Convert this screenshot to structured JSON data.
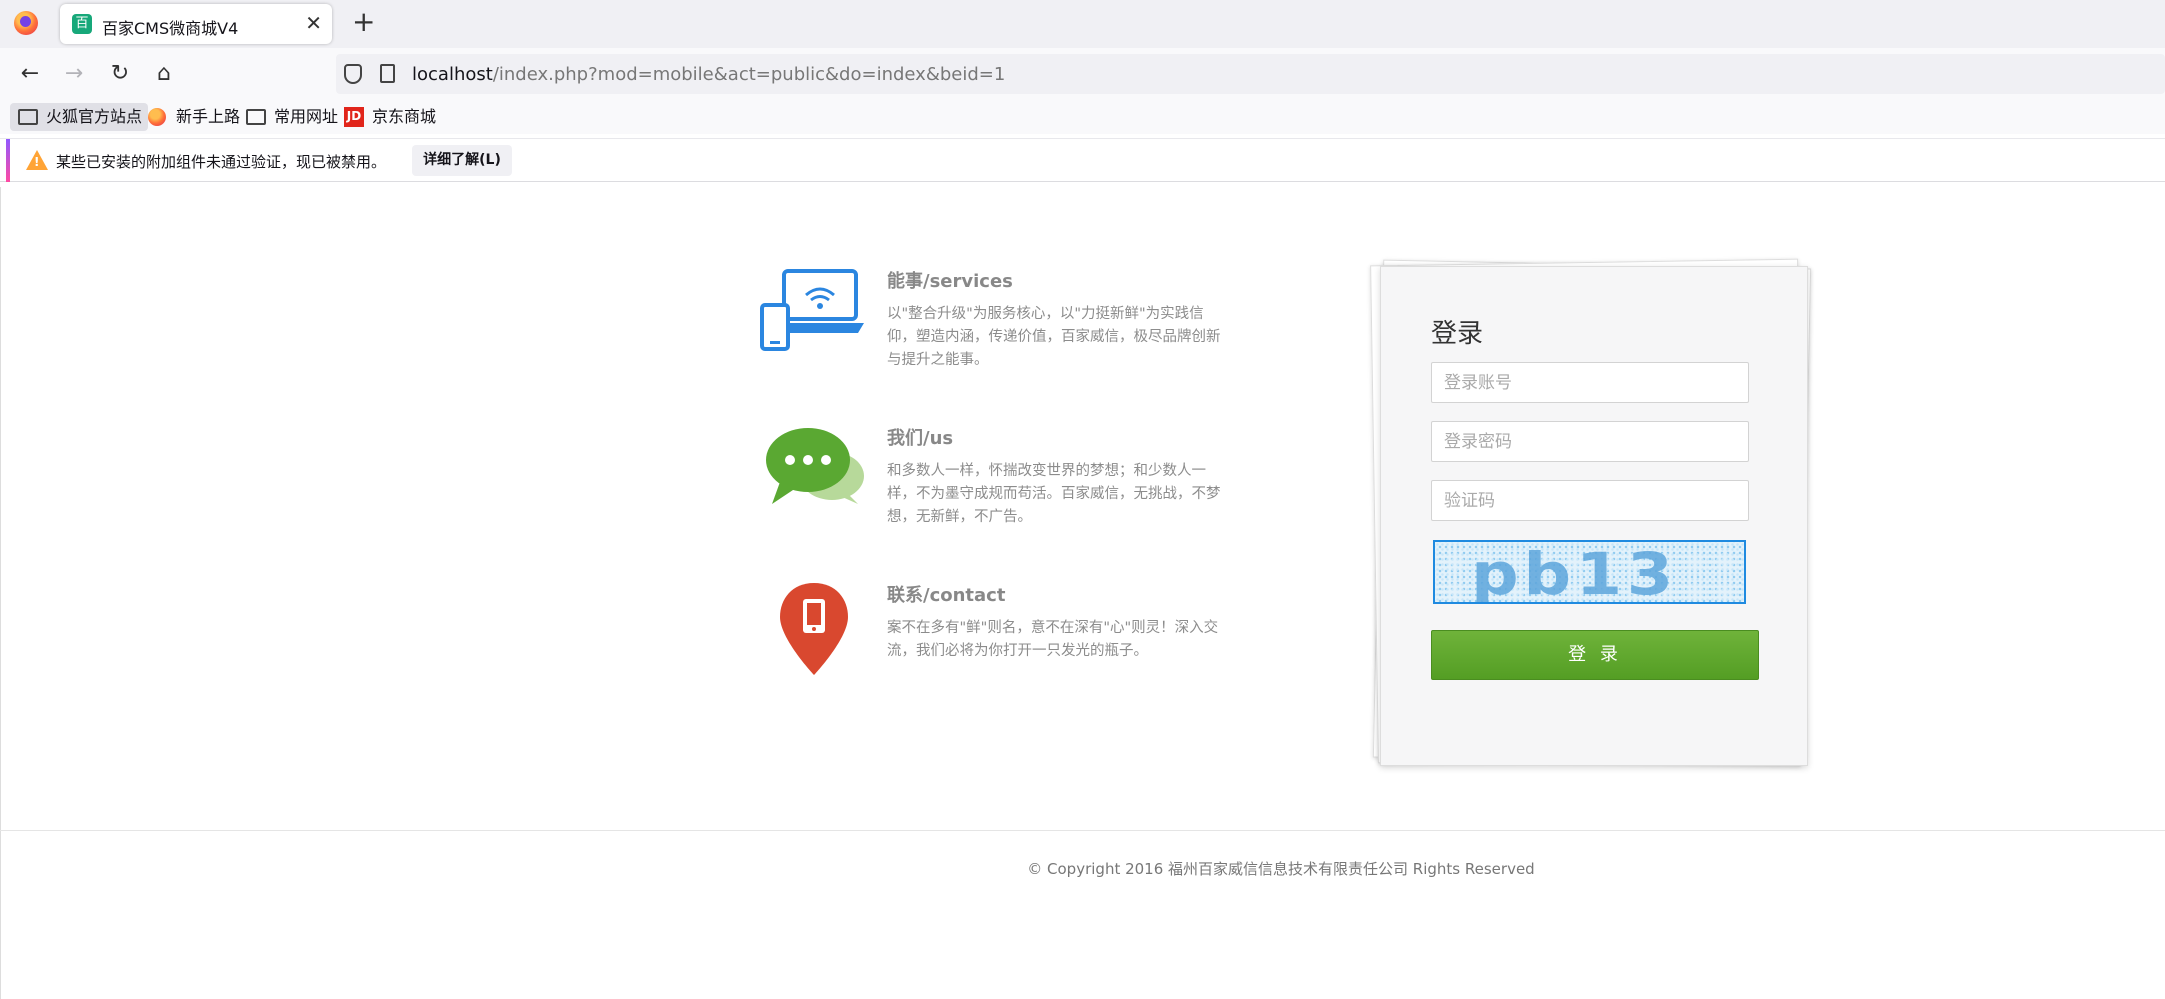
{
  "browser": {
    "tab_title": "百家CMS微商城V4",
    "tab_favicon": "百",
    "close_symbol": "✕",
    "new_tab_symbol": "+",
    "nav": {
      "back": "←",
      "forward": "→",
      "reload": "↻",
      "home": "⌂"
    },
    "url_host": "localhost",
    "url_path": "/index.php?mod=mobile&act=public&do=index&beid=1",
    "bookmarks": [
      {
        "label": "火狐官方站点",
        "icon": "folder-icon"
      },
      {
        "label": "新手上路",
        "icon": "firefox-icon"
      },
      {
        "label": "常用网址",
        "icon": "folder-icon"
      },
      {
        "label": "京东商城",
        "icon": "jd-icon",
        "icon_text": "JD"
      }
    ],
    "notification": {
      "text": "某些已安装的附加组件未通过验证，现已被禁用。",
      "button": "详细了解(L)"
    }
  },
  "features": [
    {
      "icon": "laptop-wifi-icon",
      "title": "能事/services",
      "text": "以\"整合升级\"为服务核心，以\"力挺新鲜\"为实践信仰，塑造内涵，传递价值，百家威信，极尽品牌创新与提升之能事。"
    },
    {
      "icon": "chat-bubbles-icon",
      "title": "我们/us",
      "text": "和多数人一样，怀揣改变世界的梦想；和少数人一样，不为墨守成规而苟活。百家威信，无挑战，不梦想，无新鲜，不广告。"
    },
    {
      "icon": "map-pin-phone-icon",
      "title": "联系/contact",
      "text": "案不在多有\"鲜\"则名，意不在深有\"心\"则灵！深入交流，我们必将为你打开一只发光的瓶子。"
    }
  ],
  "login": {
    "title": "登录",
    "username_placeholder": "登录账号",
    "password_placeholder": "登录密码",
    "captcha_placeholder": "验证码",
    "captcha_text": "pb13",
    "submit_label": "登 录"
  },
  "footer": {
    "copyright": "© Copyright 2016 福州百家威信信息技术有限责任公司 Rights Reserved"
  },
  "colors": {
    "accent_green": "#5fa82c",
    "icon_blue": "#2b86e0",
    "icon_green": "#5aa832",
    "icon_red": "#d9482f"
  }
}
